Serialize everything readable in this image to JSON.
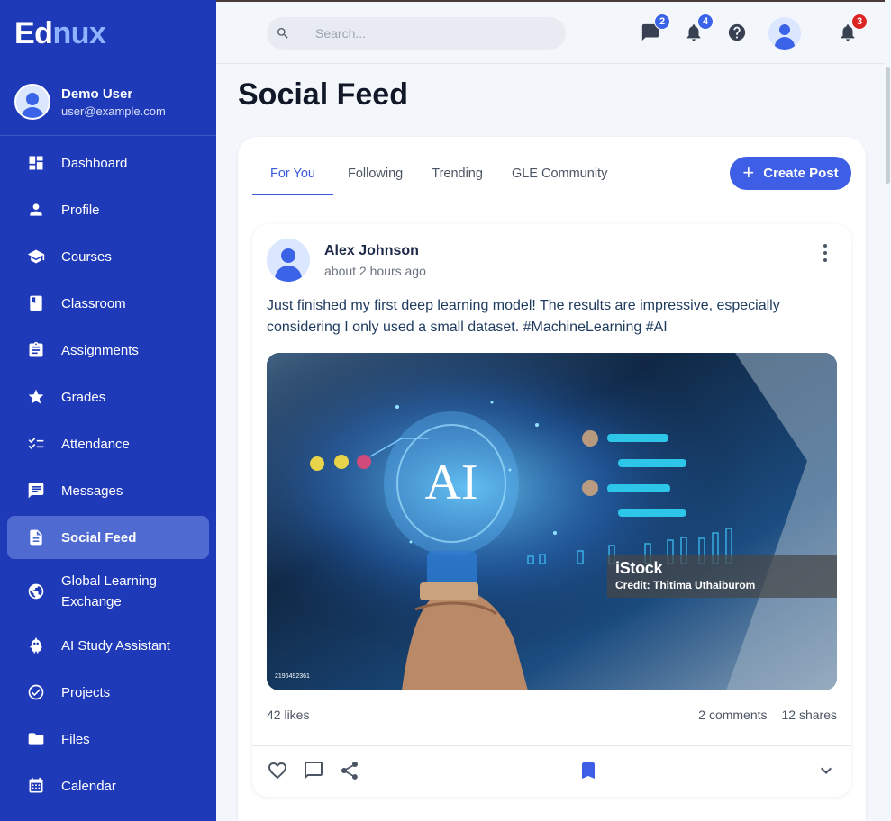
{
  "brand": {
    "part1": "Ed",
    "part2": "nux"
  },
  "user": {
    "name": "Demo User",
    "email": "user@example.com"
  },
  "sidebar": {
    "items": [
      {
        "label": "Dashboard",
        "icon": "dashboard-icon"
      },
      {
        "label": "Profile",
        "icon": "person-icon"
      },
      {
        "label": "Courses",
        "icon": "school-icon"
      },
      {
        "label": "Classroom",
        "icon": "book-icon"
      },
      {
        "label": "Assignments",
        "icon": "clipboard-icon"
      },
      {
        "label": "Grades",
        "icon": "star-icon"
      },
      {
        "label": "Attendance",
        "icon": "checklist-icon"
      },
      {
        "label": "Messages",
        "icon": "chat-icon"
      },
      {
        "label": "Social Feed",
        "icon": "article-icon",
        "active": true
      },
      {
        "label": "Global Learning Exchange",
        "icon": "globe-icon"
      },
      {
        "label": "AI Study Assistant",
        "icon": "robot-icon"
      },
      {
        "label": "Projects",
        "icon": "check-circle-icon"
      },
      {
        "label": "Files",
        "icon": "folder-icon"
      },
      {
        "label": "Calendar",
        "icon": "calendar-icon"
      }
    ]
  },
  "topbar": {
    "search_placeholder": "Search...",
    "messages_badge": "2",
    "notifications_badge": "4",
    "alerts_badge": "3"
  },
  "page": {
    "title": "Social Feed"
  },
  "tabs": [
    "For You",
    "Following",
    "Trending",
    "GLE Community"
  ],
  "create_post_label": "Create Post",
  "post": {
    "author": "Alex Johnson",
    "time": "about 2 hours ago",
    "text": "Just finished my first deep learning model! The results are impressive, especially considering I only used a small dataset. #MachineLearning #AI",
    "image_text": "AI",
    "image_brand": "iStock",
    "image_credit": "Credit: Thitima Uthaiburom",
    "image_id": "2196492361",
    "likes": "42 likes",
    "comments": "2 comments",
    "shares": "12 shares"
  },
  "colors": {
    "sidebar": "#1f3ab8",
    "accent": "#3f5ee6",
    "badge_red": "#dc2626"
  }
}
